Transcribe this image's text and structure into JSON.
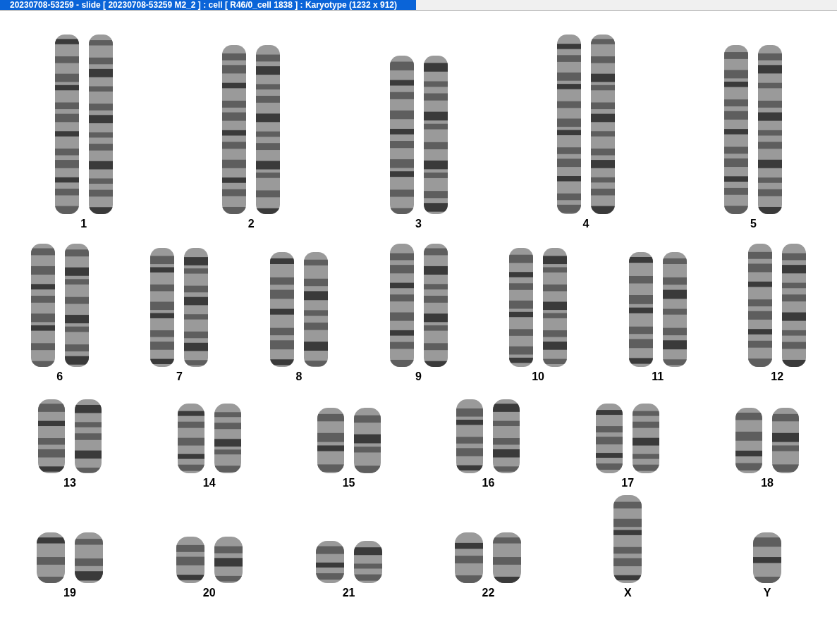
{
  "window": {
    "title": "20230708-53259 - slide [ 20230708-53259 M2_2 ] : cell [ R46/0_cell 1838 ] : Karyotype  (1232 x 912)"
  },
  "karyotype": {
    "rows": [
      {
        "groups": [
          {
            "label": "1",
            "kind": "pair"
          },
          {
            "label": "2",
            "kind": "pair"
          },
          {
            "label": "3",
            "kind": "pair"
          },
          {
            "label": "4",
            "kind": "pair"
          },
          {
            "label": "5",
            "kind": "pair"
          }
        ]
      },
      {
        "groups": [
          {
            "label": "6",
            "kind": "pair"
          },
          {
            "label": "7",
            "kind": "pair"
          },
          {
            "label": "8",
            "kind": "pair"
          },
          {
            "label": "9",
            "kind": "pair"
          },
          {
            "label": "10",
            "kind": "pair"
          },
          {
            "label": "11",
            "kind": "pair"
          },
          {
            "label": "12",
            "kind": "pair"
          }
        ]
      },
      {
        "groups": [
          {
            "label": "13",
            "kind": "pair"
          },
          {
            "label": "14",
            "kind": "pair"
          },
          {
            "label": "15",
            "kind": "pair"
          },
          {
            "label": "16",
            "kind": "pair"
          },
          {
            "label": "17",
            "kind": "pair"
          },
          {
            "label": "18",
            "kind": "pair"
          }
        ]
      },
      {
        "groups": [
          {
            "label": "19",
            "kind": "pair"
          },
          {
            "label": "20",
            "kind": "pair"
          },
          {
            "label": "21",
            "kind": "pair"
          },
          {
            "label": "22",
            "kind": "pair"
          },
          {
            "label": "X",
            "kind": "single"
          },
          {
            "label": "Y",
            "kind": "single"
          }
        ]
      }
    ]
  }
}
